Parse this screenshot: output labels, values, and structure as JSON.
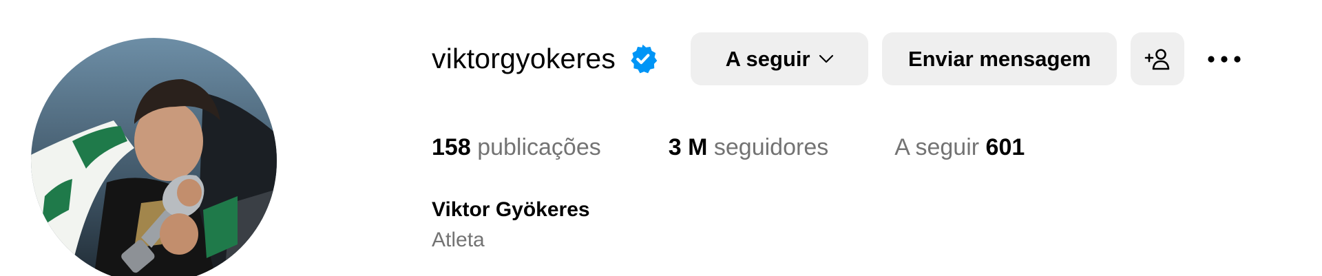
{
  "profile": {
    "username": "viktorgyokeres",
    "verified_icon": "verified-badge-icon",
    "full_name": "Viktor Gyökeres",
    "category": "Atleta"
  },
  "actions": {
    "following_label": "A seguir",
    "following_icon": "chevron-down-icon",
    "message_label": "Enviar mensagem",
    "suggest_icon": "add-user-icon",
    "more_icon": "more-options-icon"
  },
  "stats": {
    "posts_count": "158",
    "posts_label": "publicações",
    "followers_count": "3 M",
    "followers_label": "seguidores",
    "following_label": "A seguir",
    "following_count": "601"
  },
  "colors": {
    "verified_blue": "#0095f6",
    "button_bg": "#efefef",
    "secondary_text": "#737373",
    "primary_text": "#000000"
  }
}
